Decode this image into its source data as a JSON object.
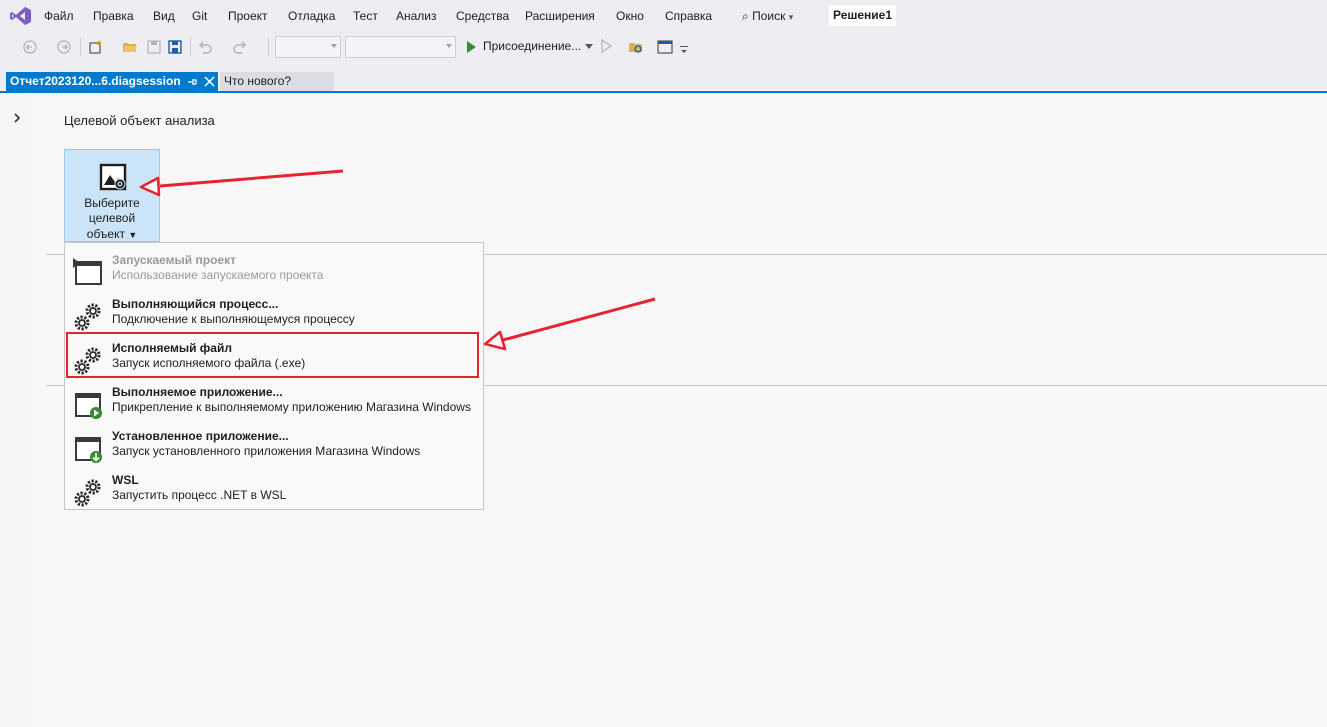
{
  "menubar": {
    "items": [
      "Файл",
      "Правка",
      "Вид",
      "Git",
      "Проект",
      "Отладка",
      "Тест",
      "Анализ",
      "Средства",
      "Расширения",
      "Окно",
      "Справка"
    ],
    "search_label": "Поиск",
    "solution_name": "Решение1"
  },
  "toolbar": {
    "attach_label": "Присоединение..."
  },
  "tabs": {
    "active": "Отчет2023120...6.diagsession",
    "inactive": "Что нового?"
  },
  "main": {
    "section_title": "Целевой объект анализа",
    "target_button": {
      "line1": "Выберите",
      "line2": "целевой",
      "line3": "объект"
    }
  },
  "dropdown": {
    "items": [
      {
        "title": "Запускаемый проект",
        "subtitle": "Использование запускаемого проекта",
        "icon": "window-play-icon",
        "disabled": true
      },
      {
        "title": "Выполняющийся процесс...",
        "subtitle": "Подключение к выполняющемуся процессу",
        "icon": "gears-icon",
        "disabled": false
      },
      {
        "title": "Исполняемый файл",
        "subtitle": "Запуск исполняемого файла (.exe)",
        "icon": "gears-icon",
        "disabled": false
      },
      {
        "title": "Выполняемое приложение...",
        "subtitle": "Прикрепление к выполняемому приложению Магазина Windows",
        "icon": "window-run-icon",
        "disabled": false
      },
      {
        "title": "Установленное приложение...",
        "subtitle": "Запуск установленного приложения Магазина Windows",
        "icon": "window-download-icon",
        "disabled": false
      },
      {
        "title": "WSL",
        "subtitle": "Запустить процесс .NET в WSL",
        "icon": "gears-icon",
        "disabled": false
      }
    ]
  },
  "colors": {
    "accent": "#007acc",
    "annotation_red": "#e8232f",
    "selected_bg": "#cce4f7"
  }
}
